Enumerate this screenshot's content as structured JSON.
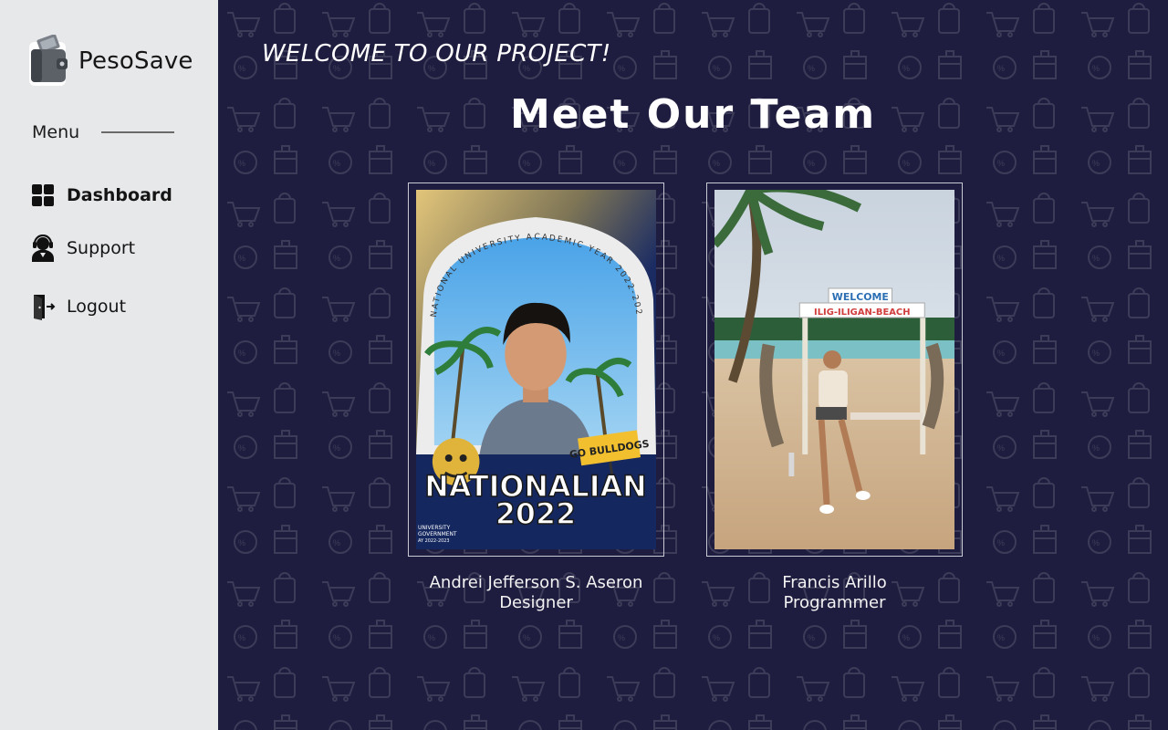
{
  "sidebar": {
    "brand_name": "PesoSave",
    "logo_icon": "wallet-logo-icon",
    "menu_label": "Menu",
    "items": [
      {
        "label": "Dashboard",
        "icon": "grid-icon"
      },
      {
        "label": "Support",
        "icon": "headset-agent-icon"
      },
      {
        "label": "Logout",
        "icon": "exit-door-icon"
      }
    ]
  },
  "main": {
    "welcome": "WELCOME TO OUR PROJECT!",
    "title": "Meet Our Team",
    "members": [
      {
        "name": "Andrei Jefferson S. Aseron",
        "role": "Designer",
        "photo": {
          "frame_arc_text": "NATIONAL UNIVERSITY ACADEMIC YEAR 2022-2023",
          "banner_line1": "NATIONALIAN",
          "banner_line2": "2022",
          "sign_text": "GO BULLDOGS",
          "footer_line1": "UNIVERSITY",
          "footer_line2": "GOVERNMENT",
          "footer_line3": "AY 2022-2023"
        }
      },
      {
        "name": "Francis Arillo",
        "role": "Programmer",
        "photo": {
          "sign_top": "WELCOME",
          "sign_bottom": "ILIG-ILIGAN-BEACH"
        }
      }
    ]
  },
  "colors": {
    "sidebar_bg": "#e7e8ea",
    "main_bg": "#1f1d3f",
    "text_light": "#ffffff"
  }
}
